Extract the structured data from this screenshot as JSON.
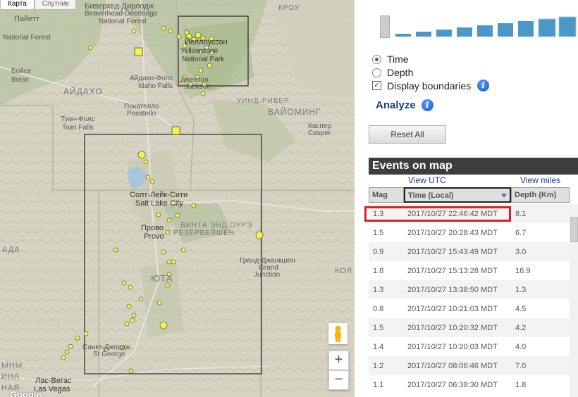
{
  "map": {
    "tabs": [
      "Карта",
      "Спутник"
    ],
    "labels": {
      "beaverhead": "Биверхед-Дирлодж",
      "beaverhead_en": "Beaverhead-Deerlodge",
      "natforest": "National Forest",
      "payette": "Пайетт",
      "natforest2": "National Forest",
      "yellowstone": "Йеллоустон",
      "yellowstone_en": "Yellowstone",
      "natpark": "National Park",
      "idahofalls": "Айдахо-Фолс",
      "idahofalls_en": "Idaho Falls",
      "jackson": "Джексон",
      "jackson_en": "Jackson",
      "boise": "Бойсе",
      "boise_en": "Boise",
      "idaho": "АЙДАХО",
      "pocatello": "Покателло",
      "pocatello_en": "Pocatello",
      "twinfalls": "Туин-Фолс",
      "twinfalls_en": "Twin Falls",
      "windriver": "УИНД-РИВЕР",
      "wyoming": "ВАЙОМИНГ",
      "casper": "Каспер",
      "casper_en": "Casper",
      "slc": "Солт-Лейк-Сити",
      "slc_en": "Salt Lake City",
      "provo": "Прово",
      "provo_en": "Provo",
      "uintah": "ВИНТА ЭНД ОУРЭ",
      "reservation": "РЕЗЕРВЕЙШЕН",
      "gj": "Гранд-Джанкшен",
      "gj_en1": "Grand",
      "gj_en2": "Junction",
      "utah": "ЮТА",
      "stgeorge": "Санкт-Джордж",
      "stgeorge_en": "St George",
      "lasvegas": "Лас-Вегас",
      "lasvegas_en": "Las Vegas",
      "krou": "КРОУ",
      "ada": "АДА",
      "kol": "КОЛ",
      "ny": "ЫНЫ",
      "ina": "ИНА",
      "nae": "НАЯ"
    },
    "zoom_in": "+",
    "zoom_out": "−",
    "logo": "Google"
  },
  "panel": {
    "radio_time": "Time",
    "radio_depth": "Depth",
    "check_boundaries": "Display boundaries",
    "analyze": "Analyze",
    "info": "i",
    "reset": "Reset All",
    "events_title": "Events on map",
    "view_utc": "View UTC",
    "view_miles": "View miles",
    "columns": {
      "mag": "Mag",
      "time": "Time (Local)",
      "depth": "Depth (Km)"
    },
    "events": [
      {
        "mag": "1.3",
        "time": "2017/10/27 22:46:42 MDT",
        "depth": "8.1"
      },
      {
        "mag": "1.5",
        "time": "2017/10/27 20:28:43 MDT",
        "depth": "6.7"
      },
      {
        "mag": "0.9",
        "time": "2017/10/27 15:43:49 MDT",
        "depth": "3.0"
      },
      {
        "mag": "1.8",
        "time": "2017/10/27 15:13:28 MDT",
        "depth": "16.9"
      },
      {
        "mag": "1.3",
        "time": "2017/10/27 13:38:50 MDT",
        "depth": "1.3"
      },
      {
        "mag": "0.8",
        "time": "2017/10/27 10:21:03 MDT",
        "depth": "4.5"
      },
      {
        "mag": "1.5",
        "time": "2017/10/27 10:20:32 MDT",
        "depth": "4.2"
      },
      {
        "mag": "1.4",
        "time": "2017/10/27 10:20:03 MDT",
        "depth": "4.0"
      },
      {
        "mag": "1.2",
        "time": "2017/10/27 08:06:46 MDT",
        "depth": "7.0"
      },
      {
        "mag": "1.1",
        "time": "2017/10/27 06:38:30 MDT",
        "depth": "1.8"
      }
    ]
  },
  "colors": {
    "quake_marker": "#f5f542",
    "highlight": "#d8202a",
    "header_bg": "#3d3d3d",
    "slider": "#4a98c8"
  }
}
